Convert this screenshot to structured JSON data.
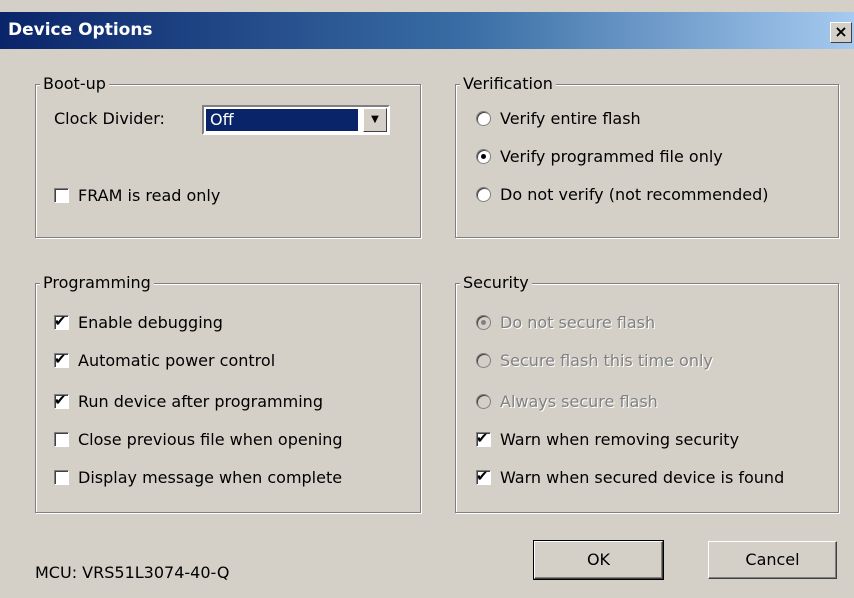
{
  "window": {
    "title": "Device Options",
    "close_glyph": "×"
  },
  "bootup": {
    "legend": "Boot-up",
    "clock_divider_label": "Clock Divider:",
    "clock_divider_value": "Off",
    "fram_label": "FRAM is read only",
    "fram_checked": false
  },
  "verification": {
    "legend": "Verification",
    "options": [
      {
        "label": "Verify entire flash",
        "selected": false
      },
      {
        "label": "Verify programmed file only",
        "selected": true
      },
      {
        "label": "Do not verify (not recommended)",
        "selected": false
      }
    ]
  },
  "programming": {
    "legend": "Programming",
    "items": [
      {
        "label": "Enable debugging",
        "checked": true
      },
      {
        "label": "Automatic power control",
        "checked": true
      },
      {
        "label": "Run device after programming",
        "checked": true
      },
      {
        "label": "Close previous file when opening",
        "checked": false
      },
      {
        "label": "Display message when complete",
        "checked": false
      }
    ]
  },
  "security": {
    "legend": "Security",
    "options": [
      {
        "label": "Do not secure flash",
        "selected": true,
        "disabled": true
      },
      {
        "label": "Secure flash this time only",
        "selected": false,
        "disabled": true
      },
      {
        "label": "Always secure flash",
        "selected": false,
        "disabled": true
      }
    ],
    "checks": [
      {
        "label": "Warn when removing security",
        "checked": true
      },
      {
        "label": "Warn when secured device is found",
        "checked": true
      }
    ]
  },
  "footer": {
    "mcu_text": "MCU: VRS51L3074-40-Q",
    "ok_label": "OK",
    "cancel_label": "Cancel"
  },
  "icons": {
    "check": "✔",
    "dropdown": "▼"
  }
}
